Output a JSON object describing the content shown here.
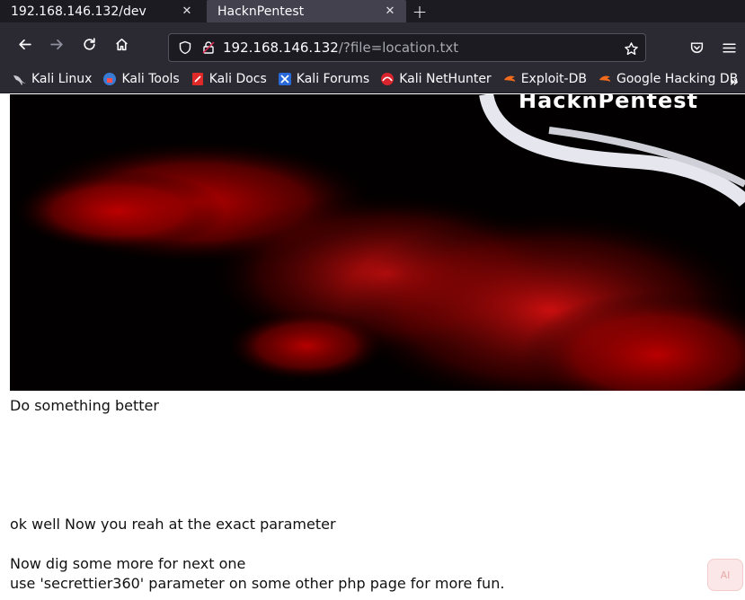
{
  "tabs": [
    {
      "title": "192.168.146.132/dev",
      "active": false
    },
    {
      "title": "HacknPentest",
      "active": true
    }
  ],
  "toolbar": {
    "new_tab_symbol": "+",
    "back_icon": "back-arrow-icon",
    "forward_icon": "forward-arrow-icon",
    "reload_icon": "reload-icon",
    "home_icon": "home-icon"
  },
  "urlbar": {
    "host": "192.168.146.132",
    "path": "/?file=location.txt"
  },
  "bookmarks": [
    {
      "label": "Kali Linux",
      "icon": "kali-dragon-icon"
    },
    {
      "label": "Kali Tools",
      "icon": "kali-tools-icon"
    },
    {
      "label": "Kali Docs",
      "icon": "kali-docs-icon"
    },
    {
      "label": "Kali Forums",
      "icon": "kali-forums-icon"
    },
    {
      "label": "Kali NetHunter",
      "icon": "kali-nethunter-icon"
    },
    {
      "label": "Exploit-DB",
      "icon": "exploit-db-icon"
    },
    {
      "label": "Google Hacking DB",
      "icon": "ghdb-icon"
    }
  ],
  "bookmarks_more": "»",
  "page": {
    "banner_logo": "HacknPentest",
    "line1": "Do something better",
    "line2": "ok well Now you reah at the exact parameter",
    "line3": "Now dig some more for next one",
    "line4": "use 'secrettier360' parameter on some other php page for more fun."
  },
  "colors": {
    "tab_bg": "#1c1b22",
    "toolbar_bg": "#2b2a33",
    "banner_red": "#b00000"
  }
}
